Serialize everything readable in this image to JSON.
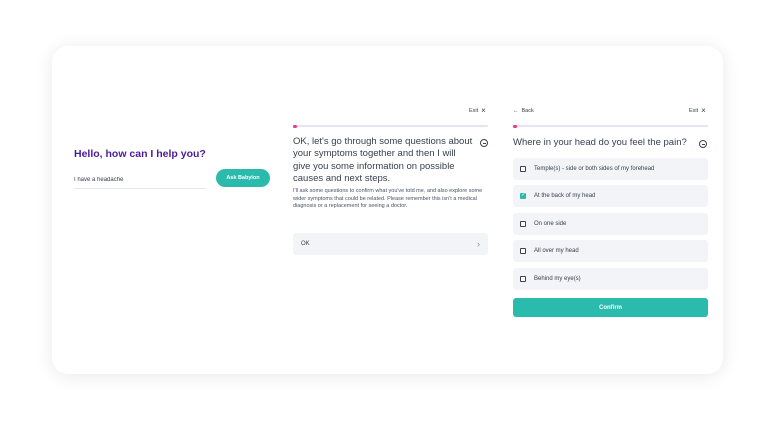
{
  "panel1": {
    "title": "Hello, how can I help you?",
    "input_value": "I have a headache",
    "button_label": "Ask Babylon"
  },
  "panel2": {
    "exit_label": "Exit",
    "progress_fraction": 0.02,
    "heading": "OK, let's go through some questions about your symptoms together and then I will give you some information on possible causes and next steps.",
    "body": "I'll ask some questions to confirm what you've told me, and also explore some wider symptoms that could be related. Please remember this isn't a medical diagnosis or a replacement for seeing a doctor.",
    "ok_label": "OK"
  },
  "panel3": {
    "back_label": "Back",
    "exit_label": "Exit",
    "progress_fraction": 0.02,
    "question": "Where in your head do you feel the pain?",
    "options": [
      {
        "label": "Temple(s) - side or both sides of my forehead",
        "checked": false
      },
      {
        "label": "At the back of my head",
        "checked": true
      },
      {
        "label": "On one side",
        "checked": false
      },
      {
        "label": "All over my head",
        "checked": false
      },
      {
        "label": "Behind my eye(s)",
        "checked": false
      }
    ],
    "confirm_label": "Confirm"
  },
  "colors": {
    "accent_teal": "#2bbbad",
    "title_purple": "#4b1b9e",
    "progress_pink": "#e6398c"
  }
}
